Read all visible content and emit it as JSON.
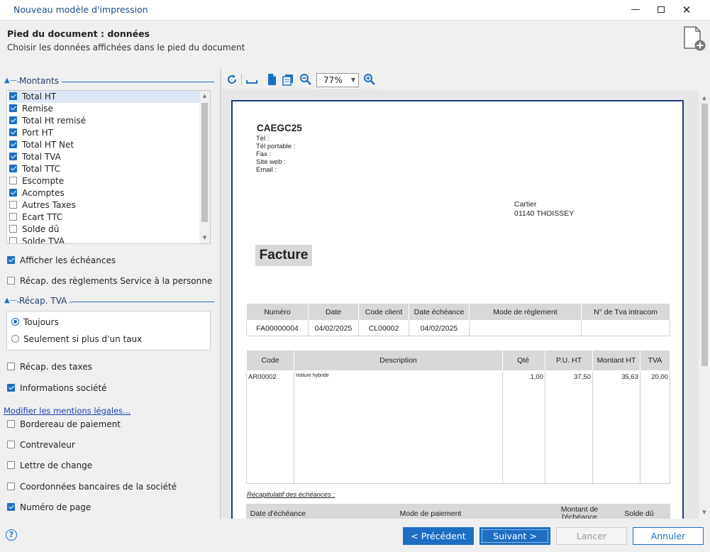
{
  "window": {
    "title": "Nouveau modèle d'impression"
  },
  "header": {
    "title": "Pied du document : données",
    "subtitle": "Choisir les données affichées dans le pied du document"
  },
  "montants": {
    "label": "Montants",
    "items": [
      {
        "label": "Total HT",
        "checked": true,
        "selected": true
      },
      {
        "label": "Remise",
        "checked": true
      },
      {
        "label": "Total Ht remisé",
        "checked": true
      },
      {
        "label": "Port HT",
        "checked": true
      },
      {
        "label": "Total HT Net",
        "checked": true
      },
      {
        "label": "Total TVA",
        "checked": true
      },
      {
        "label": "Total TTC",
        "checked": true
      },
      {
        "label": "Escompte",
        "checked": false
      },
      {
        "label": "Acomptes",
        "checked": true
      },
      {
        "label": "Autres Taxes",
        "checked": false
      },
      {
        "label": "Ecart TTC",
        "checked": false
      },
      {
        "label": "Solde dû",
        "checked": false
      },
      {
        "label": "Solde TVA",
        "checked": false
      }
    ]
  },
  "options_top": [
    {
      "label": "Afficher les échéances",
      "checked": true
    },
    {
      "label": "Récap. des règlements Service à la personne",
      "checked": false
    }
  ],
  "recap_tva": {
    "label": "Récap. TVA",
    "options": [
      {
        "label": "Toujours",
        "selected": true
      },
      {
        "label": "Seulement si plus d'un taux",
        "selected": false
      }
    ]
  },
  "options_bottom": [
    {
      "label": "Récap. des taxes",
      "checked": false
    },
    {
      "label": "Informations société",
      "checked": true
    }
  ],
  "mentions_link": "Modifier les mentions légales...",
  "options_more": [
    {
      "label": "Bordereau de paiement",
      "checked": false
    },
    {
      "label": "Contrevaleur",
      "checked": false
    },
    {
      "label": "Lettre de change",
      "checked": false
    },
    {
      "label": "Coordonnées bancaires de la société",
      "checked": false
    },
    {
      "label": "Numéro de page",
      "checked": true
    }
  ],
  "toolbar": {
    "zoom": "77%"
  },
  "document": {
    "company": "CAEGC25",
    "info_lines": [
      "Tél :",
      "Tél portable :",
      "Fax :",
      "Site web :",
      "Email :"
    ],
    "client_name": "Cartier",
    "client_city": "01140 THOISSEY",
    "doc_title": "Facture",
    "header_table": {
      "columns": [
        "Numéro",
        "Date",
        "Code client",
        "Date échéance",
        "Mode de règlement",
        "N° de Tva intracom"
      ],
      "row": [
        "FA00000004",
        "04/02/2025",
        "CL00002",
        "04/02/2025",
        "",
        ""
      ]
    },
    "lines_table": {
      "columns": [
        "Code",
        "Description",
        "Qté",
        "P.U. HT",
        "Montant HT",
        "TVA"
      ],
      "row": [
        "AR00002",
        "Voiture hybride",
        "1,00",
        "37,50",
        "35,63",
        "20,00"
      ]
    },
    "recap_title": "Récapitulatif des échéances :",
    "recap_table": {
      "columns": [
        "Date d'échéance",
        "Mode de paiement",
        "Montant de l'échéance",
        "Solde dû"
      ]
    }
  },
  "footer": {
    "prev": "< Précédent",
    "next": "Suivant >",
    "launch": "Lancer",
    "cancel": "Annuler"
  },
  "colors": {
    "accent": "#1e6fc4",
    "title": "#1f4e8c"
  }
}
